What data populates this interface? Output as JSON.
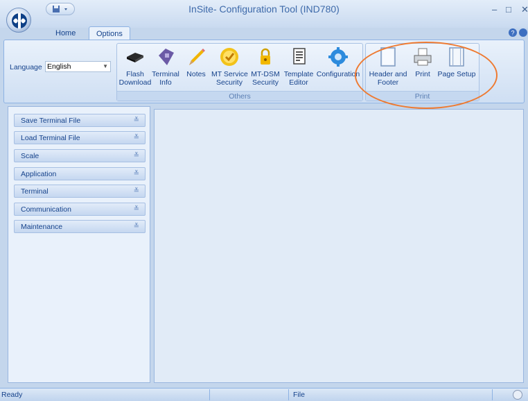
{
  "window": {
    "title": "InSite- Configuration Tool (IND780)",
    "minimize": "–",
    "maximize": "□",
    "close": "✕"
  },
  "tabs": [
    {
      "label": "Home"
    },
    {
      "label": "Options"
    }
  ],
  "language": {
    "label": "Language",
    "value": "English"
  },
  "ribbon": {
    "groups": [
      {
        "label": "Others"
      },
      {
        "label": "Print"
      }
    ],
    "buttons": [
      {
        "label": "Flash\nDownload",
        "icon": "chip-icon"
      },
      {
        "label": "Terminal\nInfo",
        "icon": "info-tag-icon"
      },
      {
        "label": "Notes",
        "icon": "pencil-icon"
      },
      {
        "label": "MT Service\nSecurity",
        "icon": "service-seal-icon"
      },
      {
        "label": "MT-DSM\nSecurity",
        "icon": "padlock-icon"
      },
      {
        "label": "Template\nEditor",
        "icon": "template-icon"
      },
      {
        "label": "Configuration",
        "icon": "gear-icon"
      },
      {
        "label": "Header and\nFooter",
        "icon": "page-blank-icon"
      },
      {
        "label": "Print",
        "icon": "printer-icon"
      },
      {
        "label": "Page Setup",
        "icon": "page-setup-icon"
      }
    ]
  },
  "sidebar": {
    "items": [
      {
        "label": "Save Terminal File"
      },
      {
        "label": "Load Terminal File"
      },
      {
        "label": "Scale"
      },
      {
        "label": "Application"
      },
      {
        "label": "Terminal"
      },
      {
        "label": "Communication"
      },
      {
        "label": "Maintenance"
      }
    ]
  },
  "status": {
    "ready": "Ready",
    "file": "File"
  },
  "colors": {
    "accent": "#15428b",
    "highlight": "#ee7a31",
    "ribbon": "#d5e3f5"
  }
}
